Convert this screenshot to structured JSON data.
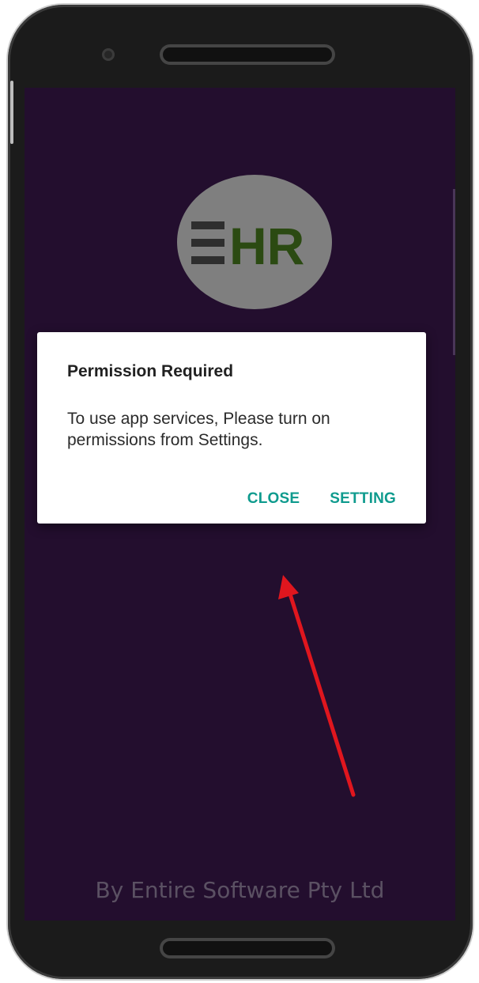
{
  "app": {
    "logo_text": "EHR",
    "footer": "By Entire Software Pty Ltd"
  },
  "dialog": {
    "title": "Permission Required",
    "message": "To use app services, Please turn on permissions from Settings.",
    "buttons": {
      "close": "CLOSE",
      "setting": "SETTING"
    }
  },
  "colors": {
    "screen_background": "#230e2e",
    "logo_circle": "#7f7f7f",
    "logo_text": "#2b4a12",
    "dialog_button": "#0f9b8e",
    "annotation_arrow": "#e0161e"
  },
  "icons": {
    "logo": "ehr-logo-icon",
    "annotation": "red-arrow-icon"
  }
}
